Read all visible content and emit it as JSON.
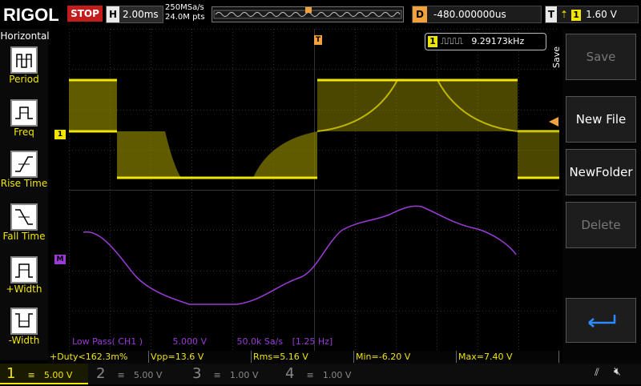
{
  "header": {
    "logo": "RIGOL",
    "run_state": "STOP",
    "timebase_label": "H",
    "timebase": "2.00ms",
    "sample_rate": "250MSa/s",
    "memory_depth": "24.0M pts",
    "delay_label": "D",
    "delay": "-480.000000us",
    "trigger_label": "T",
    "trigger_channel": "1",
    "trigger_level": "1.60 V"
  },
  "horizontal_panel": {
    "title": "Horizontal",
    "items": [
      {
        "label": "Period"
      },
      {
        "label": "Freq"
      },
      {
        "label": "Rise Time"
      },
      {
        "label": "Fall Time"
      },
      {
        "label": "+Width"
      },
      {
        "label": "-Width"
      }
    ]
  },
  "right_panel": {
    "title": "Save",
    "buttons": [
      {
        "label": "Save",
        "enabled": false
      },
      {
        "label": "New File",
        "enabled": true
      },
      {
        "label": "NewFolder",
        "enabled": true
      },
      {
        "label": "Delete",
        "enabled": false
      }
    ]
  },
  "frequency_counter": {
    "channel": "1",
    "value": "9.29173kHz"
  },
  "markers": {
    "ch1": "1",
    "math": "M",
    "trigger": "T"
  },
  "math_info": {
    "source": "Low Pass( CH1 )",
    "scale": "5.000 V",
    "rate": "50.0k Sa/s",
    "cutoff": "[1.25 Hz]"
  },
  "measurements": [
    {
      "text": "+Duty<162.3m%"
    },
    {
      "text": "Vpp=13.6 V"
    },
    {
      "text": "Rms=5.16 V"
    },
    {
      "text": "Min=-6.20 V"
    },
    {
      "text": "Max=7.40 V"
    }
  ],
  "channels": [
    {
      "num": "1",
      "scale": "5.00 V",
      "active": true
    },
    {
      "num": "2",
      "scale": "5.00 V",
      "active": false
    },
    {
      "num": "3",
      "scale": "1.00 V",
      "active": false
    },
    {
      "num": "4",
      "scale": "1.00 V",
      "active": false
    }
  ],
  "colors": {
    "ch1": "#f0e600",
    "math": "#9b3bd6",
    "trigger": "#f2a13c",
    "stop": "#c41b1b"
  }
}
